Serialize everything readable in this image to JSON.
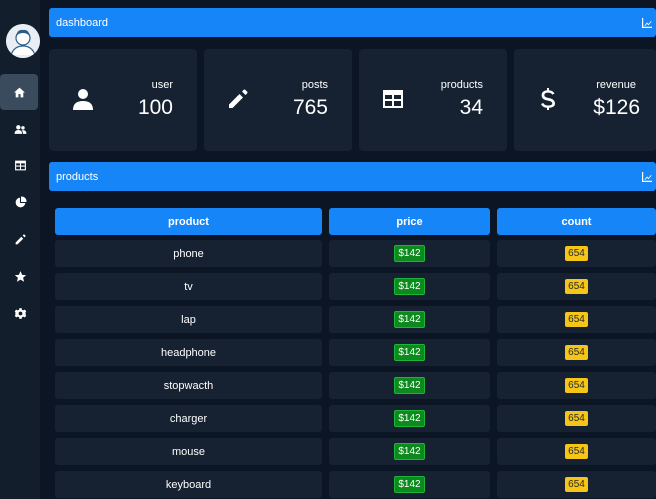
{
  "sidebar": {
    "items": [
      {
        "icon": "home-icon",
        "active": true
      },
      {
        "icon": "users-icon",
        "active": false
      },
      {
        "icon": "table-icon",
        "active": false
      },
      {
        "icon": "pie-chart-icon",
        "active": false
      },
      {
        "icon": "pencil-icon",
        "active": false
      },
      {
        "icon": "star-icon",
        "active": false
      },
      {
        "icon": "gear-icon",
        "active": false
      }
    ]
  },
  "dashboard": {
    "title": "dashboard",
    "cards": [
      {
        "label": "user",
        "value": "100",
        "icon": "user-icon"
      },
      {
        "label": "posts",
        "value": "765",
        "icon": "pencil-icon"
      },
      {
        "label": "products",
        "value": "34",
        "icon": "table-icon"
      },
      {
        "label": "revenue",
        "value": "$126",
        "icon": "dollar-icon"
      }
    ]
  },
  "products": {
    "title": "products",
    "columns": [
      "product",
      "price",
      "count"
    ],
    "rows": [
      {
        "product": "phone",
        "price": "$142",
        "count": "654"
      },
      {
        "product": "tv",
        "price": "$142",
        "count": "654"
      },
      {
        "product": "lap",
        "price": "$142",
        "count": "654"
      },
      {
        "product": "headphone",
        "price": "$142",
        "count": "654"
      },
      {
        "product": "stopwacth",
        "price": "$142",
        "count": "654"
      },
      {
        "product": "charger",
        "price": "$142",
        "count": "654"
      },
      {
        "product": "mouse",
        "price": "$142",
        "count": "654"
      },
      {
        "product": "keyboard",
        "price": "$142",
        "count": "654"
      }
    ]
  },
  "colors": {
    "accent": "#1685f8",
    "background": "#0b1524",
    "card": "#162231",
    "price_badge": "#0c8a1e",
    "count_badge": "#f5c518"
  }
}
